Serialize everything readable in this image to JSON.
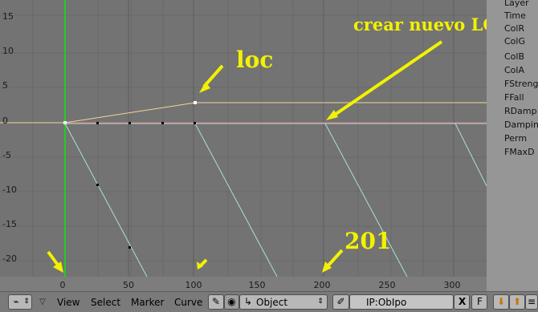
{
  "graph": {
    "y_ticks": [
      "15",
      "10",
      "5",
      "0",
      "-5",
      "-10",
      "-15",
      "-20"
    ],
    "x_ticks": [
      "0",
      "50",
      "100",
      "150",
      "200",
      "250",
      "300"
    ]
  },
  "annotations": {
    "loc": "loc",
    "crear": "crear nuevo LOC",
    "frame": "201"
  },
  "channels": [
    "Layer",
    "Time",
    "ColR",
    "ColG",
    "ColB",
    "ColA",
    "FStreng",
    "FFall",
    "RDamp",
    "Damping",
    "Perm",
    "FMaxD"
  ],
  "header": {
    "menus": {
      "view": "View",
      "select": "Select",
      "marker": "Marker",
      "curve": "Curve"
    },
    "object_label": "Object",
    "ipo_name": "IP:ObIpo",
    "close_label": "X",
    "fake_label": "F"
  },
  "colors": {
    "graph_bg": "#737373",
    "grid": "#6a6a6a",
    "green_line": "#22cc22",
    "cyan_curve": "#a8e0dc",
    "orange_curve": "#f2d49a",
    "red_line": "#e07070",
    "annotation": "#f2f200"
  }
}
